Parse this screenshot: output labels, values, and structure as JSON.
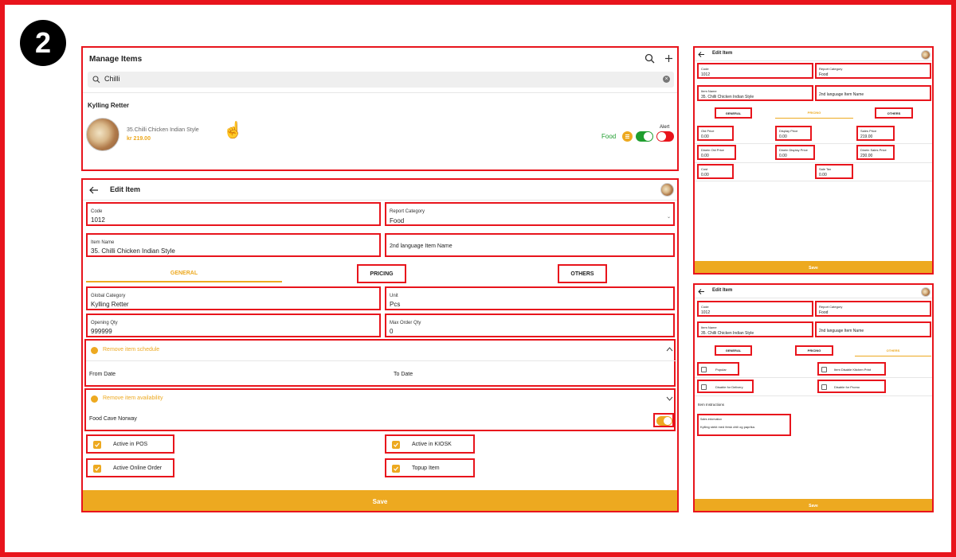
{
  "step_number": "2",
  "manage": {
    "title": "Manage Items",
    "search_value": "Chilli",
    "group_title": "Kylling Retter",
    "item": {
      "name": "35.Chilli Chicken Indian Style",
      "price": "kr 219.00",
      "category": "Food",
      "alert_label": "Alert"
    }
  },
  "edit": {
    "title": "Edit Item",
    "code_label": "Code",
    "code_value": "1012",
    "report_label": "Report Category",
    "report_value": "Food",
    "item_name_label": "Item Name",
    "item_name_value": "35. Chilli Chicken Indian Style",
    "second_lang_label": "2nd language Item Name",
    "tab_general": "GENERAL",
    "tab_pricing": "PRICING",
    "tab_others": "OTHERS",
    "global_cat_label": "Global Category",
    "global_cat_value": "Kylling Retter",
    "unit_label": "Unit",
    "unit_value": "Pcs",
    "opening_qty_label": "Opening Qty",
    "opening_qty_value": "999999",
    "max_order_label": "Max Order Qty",
    "max_order_value": "0",
    "remove_schedule": "Remove item schedule",
    "from_date": "From Date",
    "to_date": "To Date",
    "remove_availability": "Remove item availability",
    "store_name": "Food Cave Norway",
    "active_pos": "Active in POS",
    "active_kiosk": "Active in KIOSK",
    "active_online": "Active Online Order",
    "topup": "Topup Item",
    "save": "Save"
  },
  "pricing": {
    "title": "Edit Item",
    "code_label": "Code",
    "code_value": "1012",
    "report_label": "Report Category",
    "report_value": "Food",
    "item_name_label": "Item Name",
    "item_name_value": "35. Chilli Chicken Indian Style",
    "second_lang_label": "2nd language Item Name",
    "tab_general": "GENERAL",
    "tab_pricing": "PRICING",
    "tab_others": "OTHERS",
    "fields": [
      {
        "label": "Old Price",
        "value": "0.00"
      },
      {
        "label": "Display Price",
        "value": "0.00"
      },
      {
        "label": "Sales Price",
        "value": "219.00"
      },
      {
        "label": "Dinein Old Price",
        "value": "0.00"
      },
      {
        "label": "Dinein Display Price",
        "value": "0.00"
      },
      {
        "label": "Dinein Sales Price",
        "value": "230.00"
      },
      {
        "label": "Cost",
        "value": "0.00"
      },
      {
        "label": "Sale Tax",
        "value": "0.00"
      }
    ],
    "save": "Save"
  },
  "others": {
    "title": "Edit Item",
    "code_label": "Code",
    "code_value": "1012",
    "report_label": "Report Category",
    "report_value": "Food",
    "item_name_label": "Item Name",
    "item_name_value": "35. Chilli Chicken Indian Style",
    "second_lang_label": "2nd language Item Name",
    "tab_general": "GENERAL",
    "tab_pricing": "PRICING",
    "tab_others": "OTHERS",
    "popular": "Popular",
    "disable_kitchen": "Item Disable Kitchen Print",
    "disable_delivery": "Disable for Delivery",
    "disable_promo": "Disable for Promo",
    "instructions_label": "Item Instructions",
    "sales_info_label": "Sales information",
    "sales_info_value": "Kylling stekt med fersk chili og paprika.",
    "save": "Save"
  },
  "colors": {
    "accent": "#eda920",
    "highlight": "#e8141c",
    "toggle_on": "#1e9e2e",
    "toggle_alert": "#e8141c"
  }
}
